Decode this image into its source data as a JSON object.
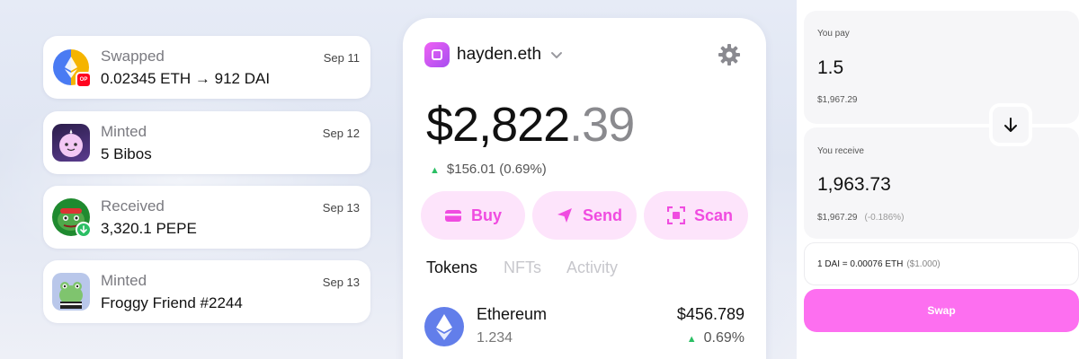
{
  "activity": [
    {
      "kind": "Swapped",
      "detail": "0.02345 ETH → 912 DAI",
      "date": "Sep 11",
      "badge": "OP"
    },
    {
      "kind": "Minted",
      "detail": "5 Bibos",
      "date": "Sep 12"
    },
    {
      "kind": "Received",
      "detail": "3,320.1 PEPE",
      "date": "Sep 13"
    },
    {
      "kind": "Minted",
      "detail": "Froggy Friend #2244",
      "date": "Sep 13"
    }
  ],
  "wallet": {
    "name": "hayden.eth",
    "balance_main": "$2,822",
    "balance_cents": ".39",
    "change": "$156.01 (0.69%)",
    "actions": [
      {
        "label": "Buy",
        "icon": "card-icon"
      },
      {
        "label": "Send",
        "icon": "send-icon"
      },
      {
        "label": "Scan",
        "icon": "scan-icon"
      }
    ],
    "tabs": [
      "Tokens",
      "NFTs",
      "Activity"
    ],
    "tokens": [
      {
        "name": "Ethereum",
        "amount": "1.234",
        "value": "$456.789",
        "change": "0.69%"
      }
    ],
    "accent": "#f04ce0",
    "positive_color": "#2bbf64"
  },
  "swap": {
    "pay_label": "You pay",
    "pay_amount": "1.5",
    "pay_usd": "$1,967.29",
    "receive_label": "You receive",
    "receive_amount": "1,963.73",
    "receive_usd": "$1,967.29",
    "receive_pct": "(-0.186%)",
    "rate": "1 DAI = 0.00076 ETH",
    "rate_usd": "($1.000)",
    "button": "Swap",
    "button_color": "#fd6ff0"
  }
}
